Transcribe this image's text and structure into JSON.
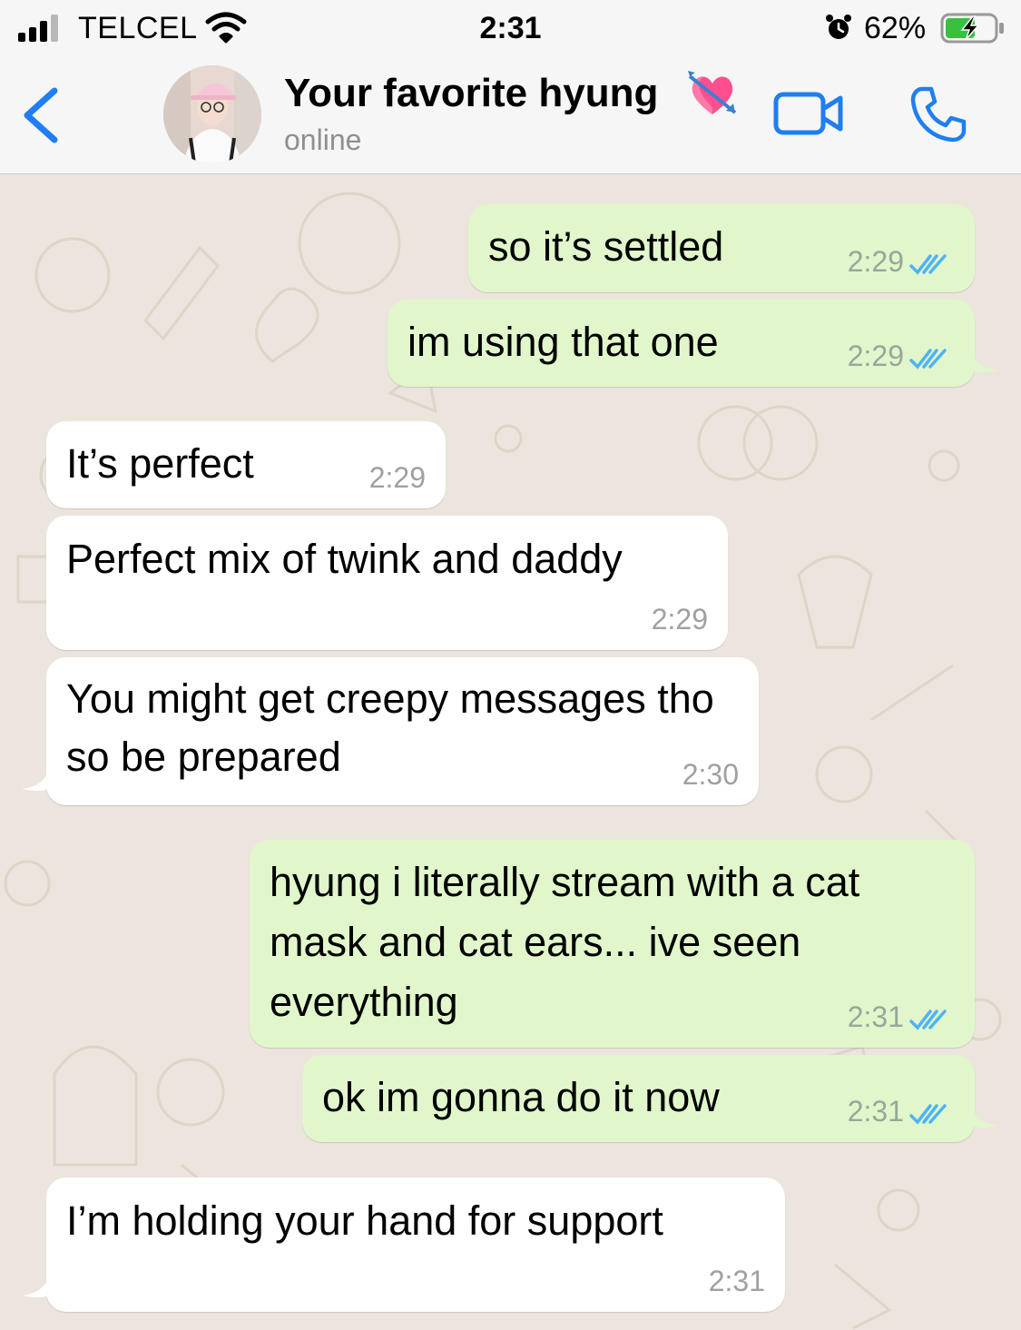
{
  "status_bar": {
    "carrier": "TELCEL",
    "time": "2:31",
    "battery_percent": "62%",
    "battery_level": 0.62,
    "icons": [
      "signal-icon",
      "wifi-icon",
      "alarm-icon",
      "battery-charging-icon"
    ]
  },
  "header": {
    "contact_name": "Your favorite hyung",
    "contact_emoji": "heart-with-arrow-icon",
    "status": "online",
    "icons": [
      "back-icon",
      "video-call-icon",
      "phone-call-icon"
    ]
  },
  "colors": {
    "accent": "#1f7ef1",
    "outgoing_bubble": "#e1f7cb",
    "incoming_bubble": "#ffffff",
    "read_ticks": "#4fb3f6",
    "chat_background": "#ece5dd"
  },
  "messages": [
    {
      "direction": "out",
      "text": "so it’s settled",
      "time": "2:29",
      "read": true
    },
    {
      "direction": "out",
      "text": "im using that one",
      "time": "2:29",
      "read": true
    },
    {
      "direction": "in",
      "text": "It’s perfect",
      "time": "2:29"
    },
    {
      "direction": "in",
      "text": "Perfect mix of twink and daddy",
      "time": "2:29"
    },
    {
      "direction": "in",
      "text": "You might get creepy messages tho so be prepared",
      "time": "2:30"
    },
    {
      "direction": "out",
      "text": "hyung i literally stream with a cat mask and cat ears... ive seen everything",
      "time": "2:31",
      "read": true
    },
    {
      "direction": "out",
      "text": "ok im gonna do it now",
      "time": "2:31",
      "read": true
    },
    {
      "direction": "in",
      "text": "I’m holding your hand for support",
      "time": "2:31"
    }
  ]
}
